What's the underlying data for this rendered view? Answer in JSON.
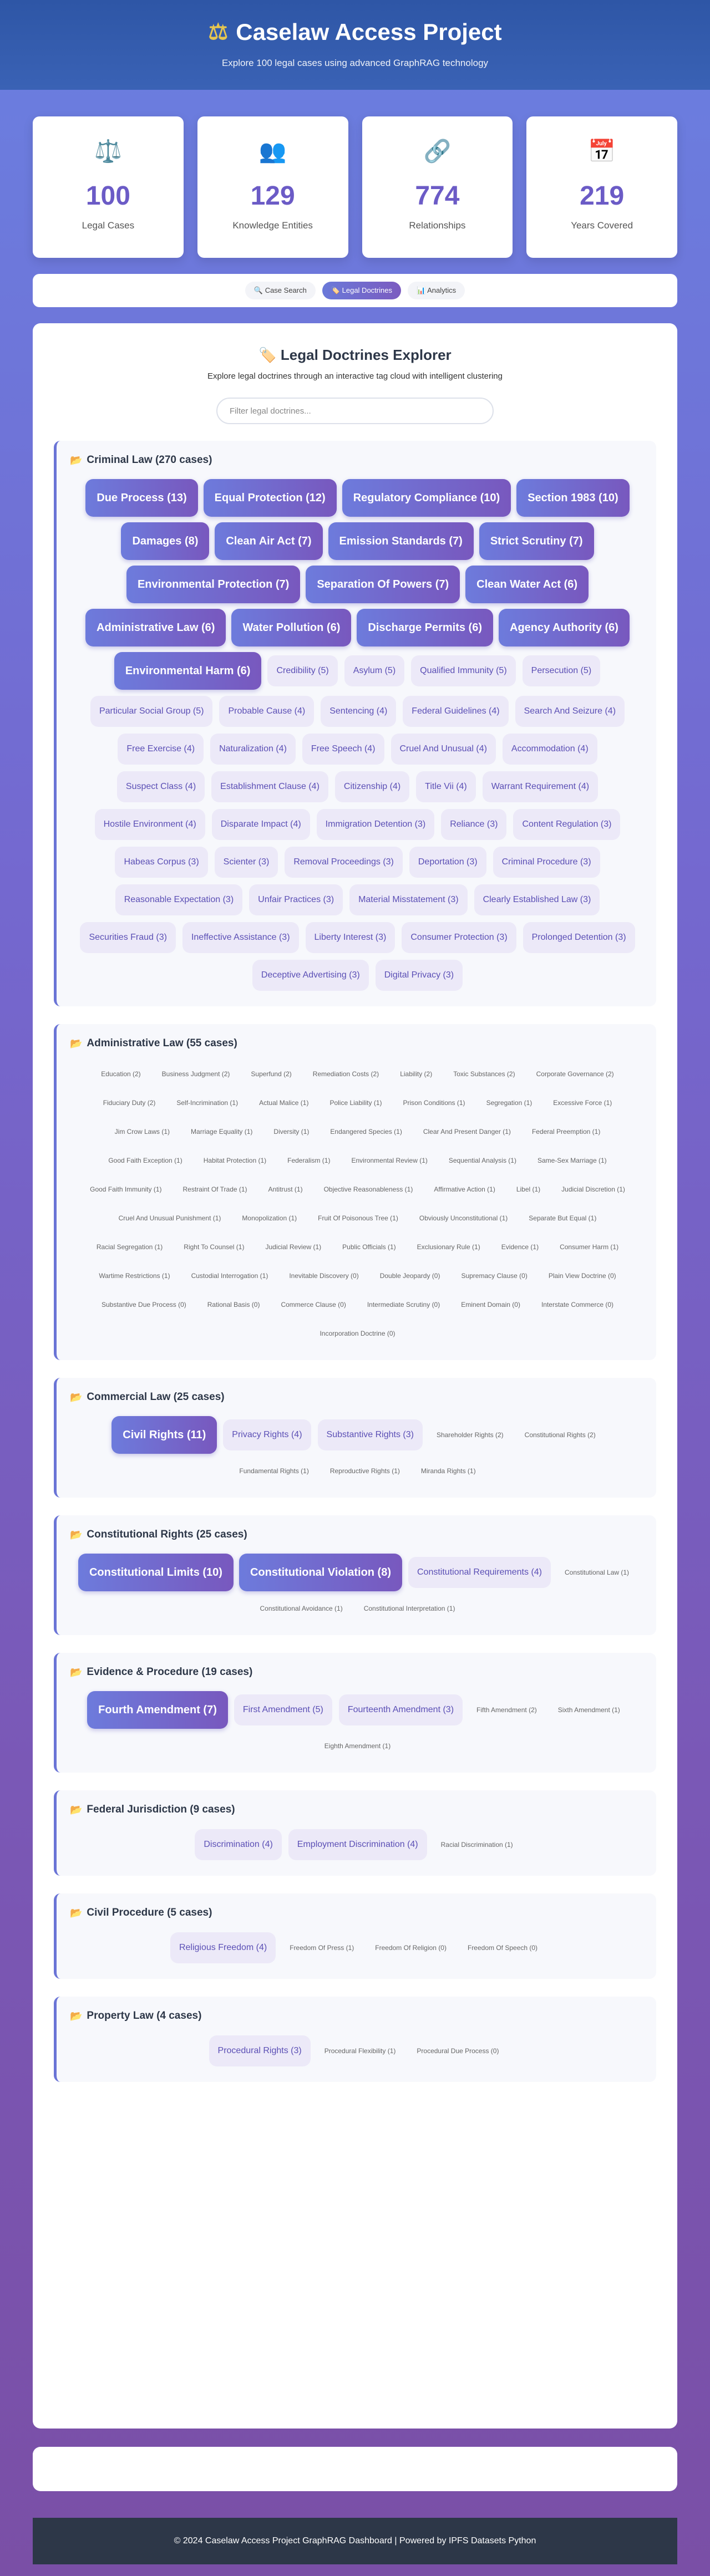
{
  "header": {
    "icon": "scale-icon",
    "title": "Caselaw Access Project",
    "subtitle": "Explore 100 legal cases using advanced GraphRAG technology"
  },
  "stats": [
    {
      "icon": "⚖️",
      "value": "100",
      "label": "Legal Cases"
    },
    {
      "icon": "👥",
      "value": "129",
      "label": "Knowledge Entities"
    },
    {
      "icon": "🔗",
      "value": "774",
      "label": "Relationships"
    },
    {
      "icon": "📅",
      "value": "219",
      "label": "Years Covered"
    }
  ],
  "tabs": [
    {
      "label": "🔍 Case Search",
      "active": false
    },
    {
      "label": "🏷️ Legal Doctrines",
      "active": true
    },
    {
      "label": "📊 Analytics",
      "active": false
    }
  ],
  "explorer": {
    "title": "🏷️ Legal Doctrines Explorer",
    "subtitle": "Explore legal doctrines through an interactive tag cloud with intelligent clustering",
    "filter_placeholder": "Filter legal doctrines..."
  },
  "categories": [
    {
      "title": "Criminal Law (270 cases)",
      "tags": [
        {
          "label": "Due Process (13)",
          "size": 1
        },
        {
          "label": "Equal Protection (12)",
          "size": 1
        },
        {
          "label": "Regulatory Compliance (10)",
          "size": 1
        },
        {
          "label": "Section 1983 (10)",
          "size": 1
        },
        {
          "label": "Damages (8)",
          "size": 1
        },
        {
          "label": "Clean Air Act (7)",
          "size": 1
        },
        {
          "label": "Emission Standards (7)",
          "size": 1
        },
        {
          "label": "Strict Scrutiny (7)",
          "size": 1
        },
        {
          "label": "Environmental Protection (7)",
          "size": 1
        },
        {
          "label": "Separation Of Powers (7)",
          "size": 1
        },
        {
          "label": "Clean Water Act (6)",
          "size": 1
        },
        {
          "label": "Administrative Law (6)",
          "size": 1
        },
        {
          "label": "Water Pollution (6)",
          "size": 1
        },
        {
          "label": "Discharge Permits (6)",
          "size": 1
        },
        {
          "label": "Agency Authority (6)",
          "size": 1
        },
        {
          "label": "Environmental Harm (6)",
          "size": 1
        },
        {
          "label": "Credibility (5)",
          "size": 2
        },
        {
          "label": "Asylum (5)",
          "size": 2
        },
        {
          "label": "Qualified Immunity (5)",
          "size": 2
        },
        {
          "label": "Persecution (5)",
          "size": 2
        },
        {
          "label": "Particular Social Group (5)",
          "size": 2
        },
        {
          "label": "Probable Cause (4)",
          "size": 2
        },
        {
          "label": "Sentencing (4)",
          "size": 2
        },
        {
          "label": "Federal Guidelines (4)",
          "size": 2
        },
        {
          "label": "Search And Seizure (4)",
          "size": 2
        },
        {
          "label": "Free Exercise (4)",
          "size": 2
        },
        {
          "label": "Naturalization (4)",
          "size": 2
        },
        {
          "label": "Free Speech (4)",
          "size": 2
        },
        {
          "label": "Cruel And Unusual (4)",
          "size": 2
        },
        {
          "label": "Accommodation (4)",
          "size": 2
        },
        {
          "label": "Suspect Class (4)",
          "size": 2
        },
        {
          "label": "Establishment Clause (4)",
          "size": 2
        },
        {
          "label": "Citizenship (4)",
          "size": 2
        },
        {
          "label": "Title Vii (4)",
          "size": 2
        },
        {
          "label": "Warrant Requirement (4)",
          "size": 2
        },
        {
          "label": "Hostile Environment (4)",
          "size": 2
        },
        {
          "label": "Disparate Impact (4)",
          "size": 2
        },
        {
          "label": "Immigration Detention (3)",
          "size": 2
        },
        {
          "label": "Reliance (3)",
          "size": 2
        },
        {
          "label": "Content Regulation (3)",
          "size": 2
        },
        {
          "label": "Habeas Corpus (3)",
          "size": 2
        },
        {
          "label": "Scienter (3)",
          "size": 2
        },
        {
          "label": "Removal Proceedings (3)",
          "size": 2
        },
        {
          "label": "Deportation (3)",
          "size": 2
        },
        {
          "label": "Criminal Procedure (3)",
          "size": 2
        },
        {
          "label": "Reasonable Expectation (3)",
          "size": 2
        },
        {
          "label": "Unfair Practices (3)",
          "size": 2
        },
        {
          "label": "Material Misstatement (3)",
          "size": 2
        },
        {
          "label": "Clearly Established Law (3)",
          "size": 2
        },
        {
          "label": "Securities Fraud (3)",
          "size": 2
        },
        {
          "label": "Ineffective Assistance (3)",
          "size": 2
        },
        {
          "label": "Liberty Interest (3)",
          "size": 2
        },
        {
          "label": "Consumer Protection (3)",
          "size": 2
        },
        {
          "label": "Prolonged Detention (3)",
          "size": 2
        },
        {
          "label": "Deceptive Advertising (3)",
          "size": 2
        },
        {
          "label": "Digital Privacy (3)",
          "size": 2
        }
      ]
    },
    {
      "title": "Administrative Law (55 cases)",
      "tags": [
        {
          "label": "Education (2)",
          "size": 3
        },
        {
          "label": "Business Judgment (2)",
          "size": 3
        },
        {
          "label": "Superfund (2)",
          "size": 3
        },
        {
          "label": "Remediation Costs (2)",
          "size": 3
        },
        {
          "label": "Liability (2)",
          "size": 3
        },
        {
          "label": "Toxic Substances (2)",
          "size": 3
        },
        {
          "label": "Corporate Governance (2)",
          "size": 3
        },
        {
          "label": "Fiduciary Duty (2)",
          "size": 3
        },
        {
          "label": "Self-Incrimination (1)",
          "size": 3
        },
        {
          "label": "Actual Malice (1)",
          "size": 3
        },
        {
          "label": "Police Liability (1)",
          "size": 3
        },
        {
          "label": "Prison Conditions (1)",
          "size": 3
        },
        {
          "label": "Segregation (1)",
          "size": 3
        },
        {
          "label": "Excessive Force (1)",
          "size": 3
        },
        {
          "label": "Jim Crow Laws (1)",
          "size": 3
        },
        {
          "label": "Marriage Equality (1)",
          "size": 3
        },
        {
          "label": "Diversity (1)",
          "size": 3
        },
        {
          "label": "Endangered Species (1)",
          "size": 3
        },
        {
          "label": "Clear And Present Danger (1)",
          "size": 3
        },
        {
          "label": "Federal Preemption (1)",
          "size": 3
        },
        {
          "label": "Good Faith Exception (1)",
          "size": 3
        },
        {
          "label": "Habitat Protection (1)",
          "size": 3
        },
        {
          "label": "Federalism (1)",
          "size": 3
        },
        {
          "label": "Environmental Review (1)",
          "size": 3
        },
        {
          "label": "Sequential Analysis (1)",
          "size": 3
        },
        {
          "label": "Same-Sex Marriage (1)",
          "size": 3
        },
        {
          "label": "Good Faith Immunity (1)",
          "size": 3
        },
        {
          "label": "Restraint Of Trade (1)",
          "size": 3
        },
        {
          "label": "Antitrust (1)",
          "size": 3
        },
        {
          "label": "Objective Reasonableness (1)",
          "size": 3
        },
        {
          "label": "Affirmative Action (1)",
          "size": 3
        },
        {
          "label": "Libel (1)",
          "size": 3
        },
        {
          "label": "Judicial Discretion (1)",
          "size": 3
        },
        {
          "label": "Cruel And Unusual Punishment (1)",
          "size": 3
        },
        {
          "label": "Monopolization (1)",
          "size": 3
        },
        {
          "label": "Fruit Of Poisonous Tree (1)",
          "size": 3
        },
        {
          "label": "Obviously Unconstitutional (1)",
          "size": 3
        },
        {
          "label": "Separate But Equal (1)",
          "size": 3
        },
        {
          "label": "Racial Segregation (1)",
          "size": 3
        },
        {
          "label": "Right To Counsel (1)",
          "size": 3
        },
        {
          "label": "Judicial Review (1)",
          "size": 3
        },
        {
          "label": "Public Officials (1)",
          "size": 3
        },
        {
          "label": "Exclusionary Rule (1)",
          "size": 3
        },
        {
          "label": "Evidence (1)",
          "size": 3
        },
        {
          "label": "Consumer Harm (1)",
          "size": 3
        },
        {
          "label": "Wartime Restrictions (1)",
          "size": 3
        },
        {
          "label": "Custodial Interrogation (1)",
          "size": 3
        },
        {
          "label": "Inevitable Discovery (0)",
          "size": 3
        },
        {
          "label": "Double Jeopardy (0)",
          "size": 3
        },
        {
          "label": "Supremacy Clause (0)",
          "size": 3
        },
        {
          "label": "Plain View Doctrine (0)",
          "size": 3
        },
        {
          "label": "Substantive Due Process (0)",
          "size": 3
        },
        {
          "label": "Rational Basis (0)",
          "size": 3
        },
        {
          "label": "Commerce Clause (0)",
          "size": 3
        },
        {
          "label": "Intermediate Scrutiny (0)",
          "size": 3
        },
        {
          "label": "Eminent Domain (0)",
          "size": 3
        },
        {
          "label": "Interstate Commerce (0)",
          "size": 3
        },
        {
          "label": "Incorporation Doctrine (0)",
          "size": 3
        }
      ]
    },
    {
      "title": "Commercial Law (25 cases)",
      "tags": [
        {
          "label": "Civil Rights (11)",
          "size": 1
        },
        {
          "label": "Privacy Rights (4)",
          "size": 2
        },
        {
          "label": "Substantive Rights (3)",
          "size": 2
        },
        {
          "label": "Shareholder Rights (2)",
          "size": 3
        },
        {
          "label": "Constitutional Rights (2)",
          "size": 3
        },
        {
          "label": "Fundamental Rights (1)",
          "size": 3
        },
        {
          "label": "Reproductive Rights (1)",
          "size": 3
        },
        {
          "label": "Miranda Rights (1)",
          "size": 3
        }
      ]
    },
    {
      "title": "Constitutional Rights (25 cases)",
      "tags": [
        {
          "label": "Constitutional Limits (10)",
          "size": 1
        },
        {
          "label": "Constitutional Violation (8)",
          "size": 1
        },
        {
          "label": "Constitutional Requirements (4)",
          "size": 2
        },
        {
          "label": "Constitutional Law (1)",
          "size": 3
        },
        {
          "label": "Constitutional Avoidance (1)",
          "size": 3
        },
        {
          "label": "Constitutional Interpretation (1)",
          "size": 3
        }
      ]
    },
    {
      "title": "Evidence & Procedure (19 cases)",
      "tags": [
        {
          "label": "Fourth Amendment (7)",
          "size": 1
        },
        {
          "label": "First Amendment (5)",
          "size": 2
        },
        {
          "label": "Fourteenth Amendment (3)",
          "size": 2
        },
        {
          "label": "Fifth Amendment (2)",
          "size": 3
        },
        {
          "label": "Sixth Amendment (1)",
          "size": 3
        },
        {
          "label": "Eighth Amendment (1)",
          "size": 3
        }
      ]
    },
    {
      "title": "Federal Jurisdiction (9 cases)",
      "tags": [
        {
          "label": "Discrimination (4)",
          "size": 2
        },
        {
          "label": "Employment Discrimination (4)",
          "size": 2
        },
        {
          "label": "Racial Discrimination (1)",
          "size": 3
        }
      ]
    },
    {
      "title": "Civil Procedure (5 cases)",
      "tags": [
        {
          "label": "Religious Freedom (4)",
          "size": 2
        },
        {
          "label": "Freedom Of Press (1)",
          "size": 3
        },
        {
          "label": "Freedom Of Religion (0)",
          "size": 3
        },
        {
          "label": "Freedom Of Speech (0)",
          "size": 3
        }
      ]
    },
    {
      "title": "Property Law (4 cases)",
      "tags": [
        {
          "label": "Procedural Rights (3)",
          "size": 2
        },
        {
          "label": "Procedural Flexibility (1)",
          "size": 3
        },
        {
          "label": "Procedural Due Process (0)",
          "size": 3
        }
      ]
    }
  ],
  "footer": {
    "text": "© 2024 Caselaw Access Project GraphRAG Dashboard | Powered by IPFS Datasets Python"
  }
}
